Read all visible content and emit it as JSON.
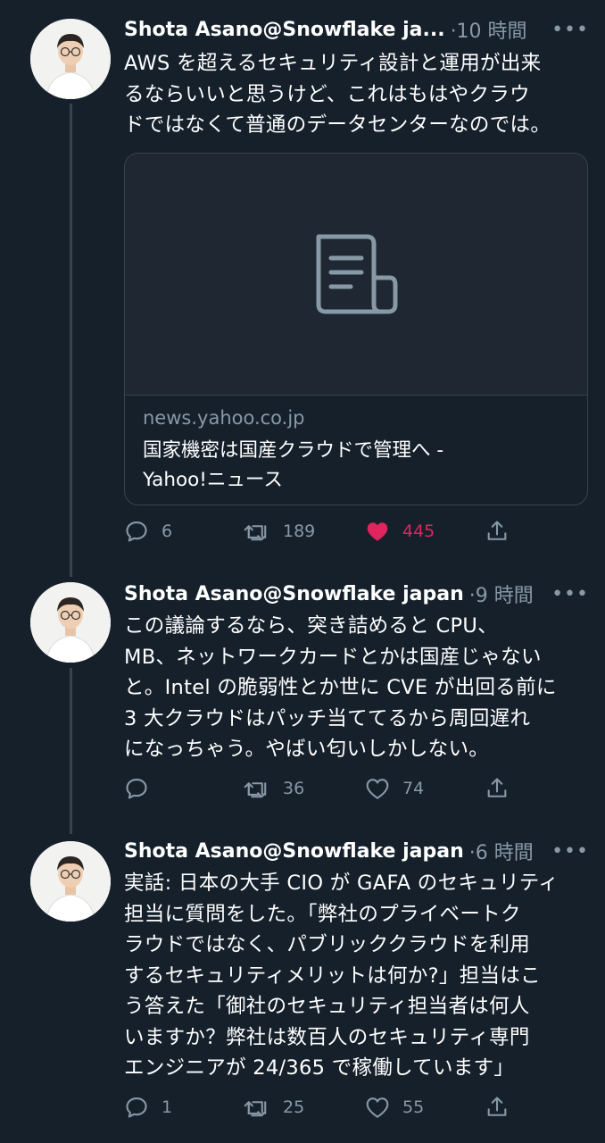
{
  "tweets": [
    {
      "author": "Shota Asano@Snowflake ja...",
      "time": "·10 時間",
      "more": "•••",
      "lines": [
        "AWS を超えるセキュリティ設計と運用が出来",
        "るならいいと思うけど、これはもはやクラウ",
        "ドではなくて普通のデータセンターなのでは。"
      ],
      "card": {
        "domain": "news.yahoo.co.jp",
        "title_lines": [
          "国家機密は国産クラウドで管理へ -",
          "Yahoo!ニュース"
        ]
      },
      "replies": "6",
      "retweets": "189",
      "likes": "445",
      "liked": true
    },
    {
      "author": "Shota Asano@Snowflake japan",
      "time": "·9 時間",
      "more": "•••",
      "lines": [
        "この議論するなら、突き詰めると CPU、",
        "MB、ネットワークカードとかは国産じゃない",
        "と。Intel の脆弱性とか世に CVE が出回る前に",
        "3 大クラウドはパッチ当ててるから周回遅れ",
        "になっちゃう。やばい匂いしかしない。"
      ],
      "replies": "",
      "retweets": "36",
      "likes": "74",
      "liked": false
    },
    {
      "author": "Shota Asano@Snowflake japan",
      "time": "·6 時間",
      "more": "•••",
      "lines": [
        "実話: 日本の大手 CIO が GAFA のセキュリティ",
        "担当に質問をした。「弊社のプライベートク",
        "ラウドではなく、パブリッククラウドを利用",
        "するセキュリティメリットは何か?」担当はこ",
        "う答えた「御社のセキュリティ担当者は何人",
        "いますか？弊社は数百人のセキュリティ専門",
        "エンジニアが 24/365 で稼働しています」"
      ],
      "replies": "1",
      "retweets": "25",
      "likes": "55",
      "liked": false
    }
  ],
  "icons": {
    "reply": "reply-icon",
    "retweet": "retweet-icon",
    "like": "heart-icon",
    "share": "share-icon",
    "article": "article-icon"
  },
  "colors": {
    "background": "#15202b",
    "muted": "#8899a6",
    "border": "#38444d",
    "like": "#e0245e"
  }
}
